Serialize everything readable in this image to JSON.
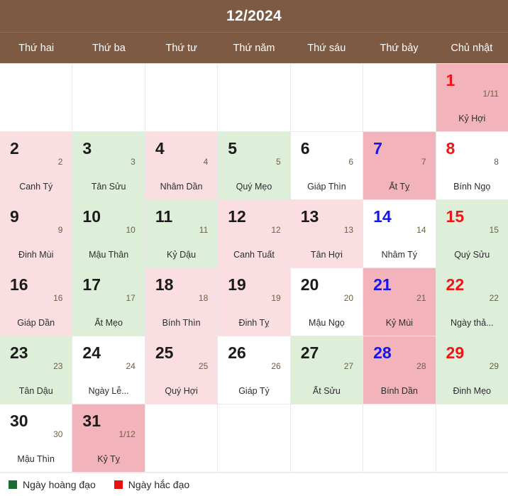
{
  "header": {
    "title": "12/2024"
  },
  "weekdays": [
    {
      "label": "Thứ hai"
    },
    {
      "label": "Thứ ba"
    },
    {
      "label": "Thứ tư"
    },
    {
      "label": "Thứ năm"
    },
    {
      "label": "Thứ sáu"
    },
    {
      "label": "Thứ bảy"
    },
    {
      "label": "Chủ nhật"
    }
  ],
  "colors": {
    "header_bg": "#7d5a43",
    "good_day_bg": "#ddeed9",
    "bad_day_bg": "#fadee1",
    "weekend_bad_bg": "#f3b3ba",
    "saturday_text": "#1414ef",
    "sunday_text": "#f01414",
    "legend_good": "#1c6b33",
    "legend_bad": "#e81010"
  },
  "weeks": [
    [
      {
        "empty": true
      },
      {
        "empty": true
      },
      {
        "empty": true
      },
      {
        "empty": true
      },
      {
        "empty": true
      },
      {
        "empty": true
      },
      {
        "solar": "1",
        "lunar": "1/11",
        "canchi": "Kỷ Hợi",
        "bg": "bad-we",
        "weekday": "sun"
      }
    ],
    [
      {
        "solar": "2",
        "lunar": "2",
        "canchi": "Canh Tý",
        "bg": "bad",
        "weekday": "wd"
      },
      {
        "solar": "3",
        "lunar": "3",
        "canchi": "Tân Sửu",
        "bg": "good",
        "weekday": "wd"
      },
      {
        "solar": "4",
        "lunar": "4",
        "canchi": "Nhâm Dần",
        "bg": "bad",
        "weekday": "wd"
      },
      {
        "solar": "5",
        "lunar": "5",
        "canchi": "Quý Mẹo",
        "bg": "good",
        "weekday": "wd"
      },
      {
        "solar": "6",
        "lunar": "6",
        "canchi": "Giáp Thìn",
        "bg": "plain",
        "weekday": "wd"
      },
      {
        "solar": "7",
        "lunar": "7",
        "canchi": "Ất Tỵ",
        "bg": "bad-we",
        "weekday": "sat"
      },
      {
        "solar": "8",
        "lunar": "8",
        "canchi": "Bính Ngọ",
        "bg": "plain",
        "weekday": "sun"
      }
    ],
    [
      {
        "solar": "9",
        "lunar": "9",
        "canchi": "Đinh Mùi",
        "bg": "bad",
        "weekday": "wd"
      },
      {
        "solar": "10",
        "lunar": "10",
        "canchi": "Mậu Thân",
        "bg": "good",
        "weekday": "wd"
      },
      {
        "solar": "11",
        "lunar": "11",
        "canchi": "Kỷ Dậu",
        "bg": "good",
        "weekday": "wd"
      },
      {
        "solar": "12",
        "lunar": "12",
        "canchi": "Canh Tuất",
        "bg": "bad",
        "weekday": "wd"
      },
      {
        "solar": "13",
        "lunar": "13",
        "canchi": "Tân Hợi",
        "bg": "bad",
        "weekday": "wd"
      },
      {
        "solar": "14",
        "lunar": "14",
        "canchi": "Nhâm Tý",
        "bg": "plain",
        "weekday": "sat"
      },
      {
        "solar": "15",
        "lunar": "15",
        "canchi": "Quý Sửu",
        "bg": "good",
        "weekday": "sun"
      }
    ],
    [
      {
        "solar": "16",
        "lunar": "16",
        "canchi": "Giáp Dần",
        "bg": "bad",
        "weekday": "wd"
      },
      {
        "solar": "17",
        "lunar": "17",
        "canchi": "Ất Mẹo",
        "bg": "good",
        "weekday": "wd"
      },
      {
        "solar": "18",
        "lunar": "18",
        "canchi": "Bính Thìn",
        "bg": "bad",
        "weekday": "wd"
      },
      {
        "solar": "19",
        "lunar": "19",
        "canchi": "Đinh Tỵ",
        "bg": "bad",
        "weekday": "wd"
      },
      {
        "solar": "20",
        "lunar": "20",
        "canchi": "Mậu Ngọ",
        "bg": "plain",
        "weekday": "wd"
      },
      {
        "solar": "21",
        "lunar": "21",
        "canchi": "Kỷ Mùi",
        "bg": "bad-we",
        "weekday": "sat"
      },
      {
        "solar": "22",
        "lunar": "22",
        "canchi": "Ngày thả...",
        "bg": "good",
        "weekday": "sun"
      }
    ],
    [
      {
        "solar": "23",
        "lunar": "23",
        "canchi": "Tân Dậu",
        "bg": "good",
        "weekday": "wd"
      },
      {
        "solar": "24",
        "lunar": "24",
        "canchi": "Ngày Lễ...",
        "bg": "plain",
        "weekday": "wd"
      },
      {
        "solar": "25",
        "lunar": "25",
        "canchi": "Quý Hợi",
        "bg": "bad",
        "weekday": "wd"
      },
      {
        "solar": "26",
        "lunar": "26",
        "canchi": "Giáp Tý",
        "bg": "plain",
        "weekday": "wd"
      },
      {
        "solar": "27",
        "lunar": "27",
        "canchi": "Ất Sửu",
        "bg": "good",
        "weekday": "wd"
      },
      {
        "solar": "28",
        "lunar": "28",
        "canchi": "Bính Dần",
        "bg": "bad-we",
        "weekday": "sat"
      },
      {
        "solar": "29",
        "lunar": "29",
        "canchi": "Đinh Mẹo",
        "bg": "good",
        "weekday": "sun"
      }
    ],
    [
      {
        "solar": "30",
        "lunar": "30",
        "canchi": "Mậu Thìn",
        "bg": "plain",
        "weekday": "wd"
      },
      {
        "solar": "31",
        "lunar": "1/12",
        "canchi": "Kỷ Tỵ",
        "bg": "bad-we",
        "weekday": "wd"
      },
      {
        "empty": true
      },
      {
        "empty": true
      },
      {
        "empty": true
      },
      {
        "empty": true
      },
      {
        "empty": true
      }
    ]
  ],
  "legend": [
    {
      "label": "Ngày hoàng đạo",
      "swatch": "good"
    },
    {
      "label": "Ngày hắc đạo",
      "swatch": "bad"
    }
  ]
}
